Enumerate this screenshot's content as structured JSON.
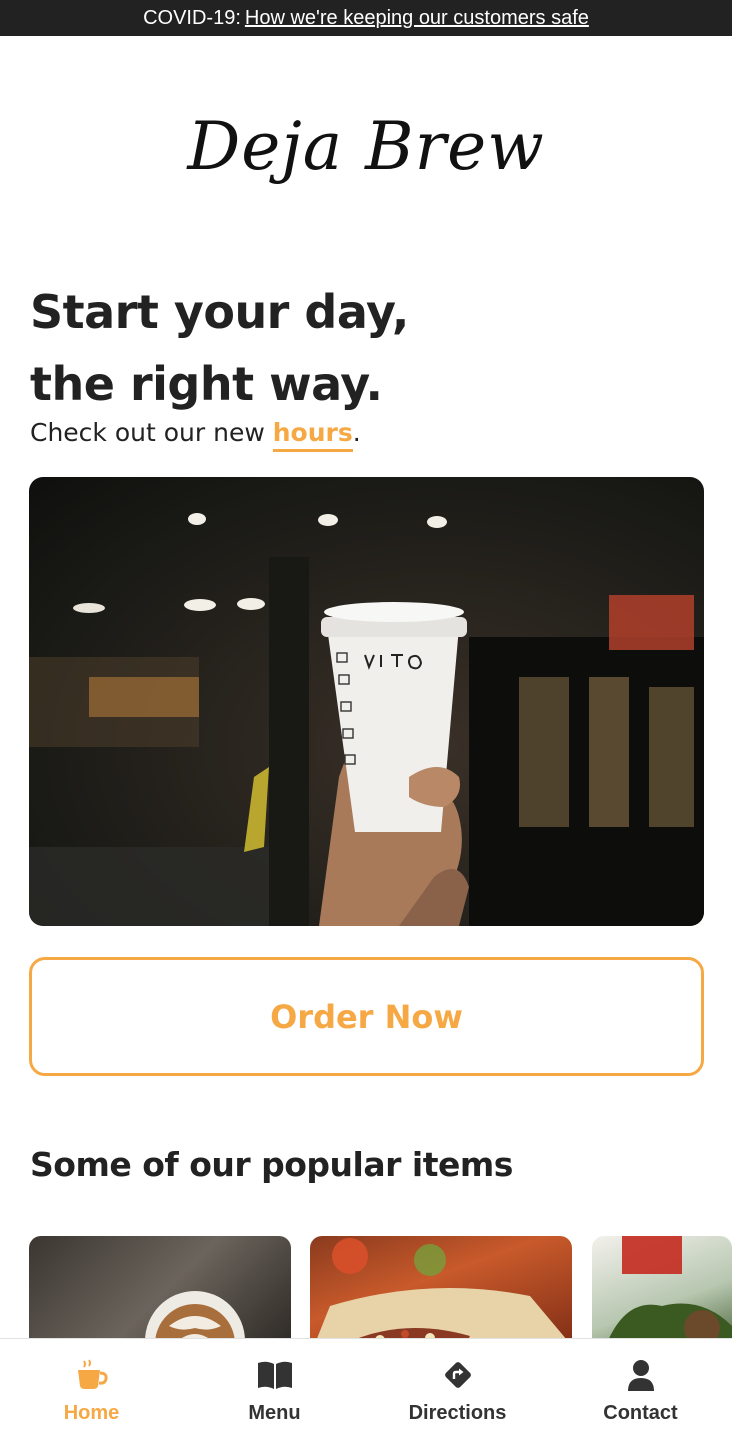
{
  "banner": {
    "prefix": "COVID-19:",
    "link_text": "How we're keeping our customers safe"
  },
  "brand": {
    "logo_text": "Deja Brew"
  },
  "hero": {
    "title_line1": "Start your day,",
    "title_line2": "the right way.",
    "subtitle_before": "Check out our new ",
    "subtitle_link": "hours",
    "subtitle_after": "."
  },
  "order_button": {
    "label": "Order Now"
  },
  "popular": {
    "title": "Some of our popular items"
  },
  "nav": {
    "items": [
      {
        "label": "Home",
        "icon": "coffee-cup-icon",
        "active": true
      },
      {
        "label": "Menu",
        "icon": "open-book-icon",
        "active": false
      },
      {
        "label": "Directions",
        "icon": "directions-sign-icon",
        "active": false
      },
      {
        "label": "Contact",
        "icon": "user-icon",
        "active": false
      }
    ]
  },
  "colors": {
    "accent": "#f6a844",
    "text": "#222222",
    "banner_bg": "#222222"
  }
}
